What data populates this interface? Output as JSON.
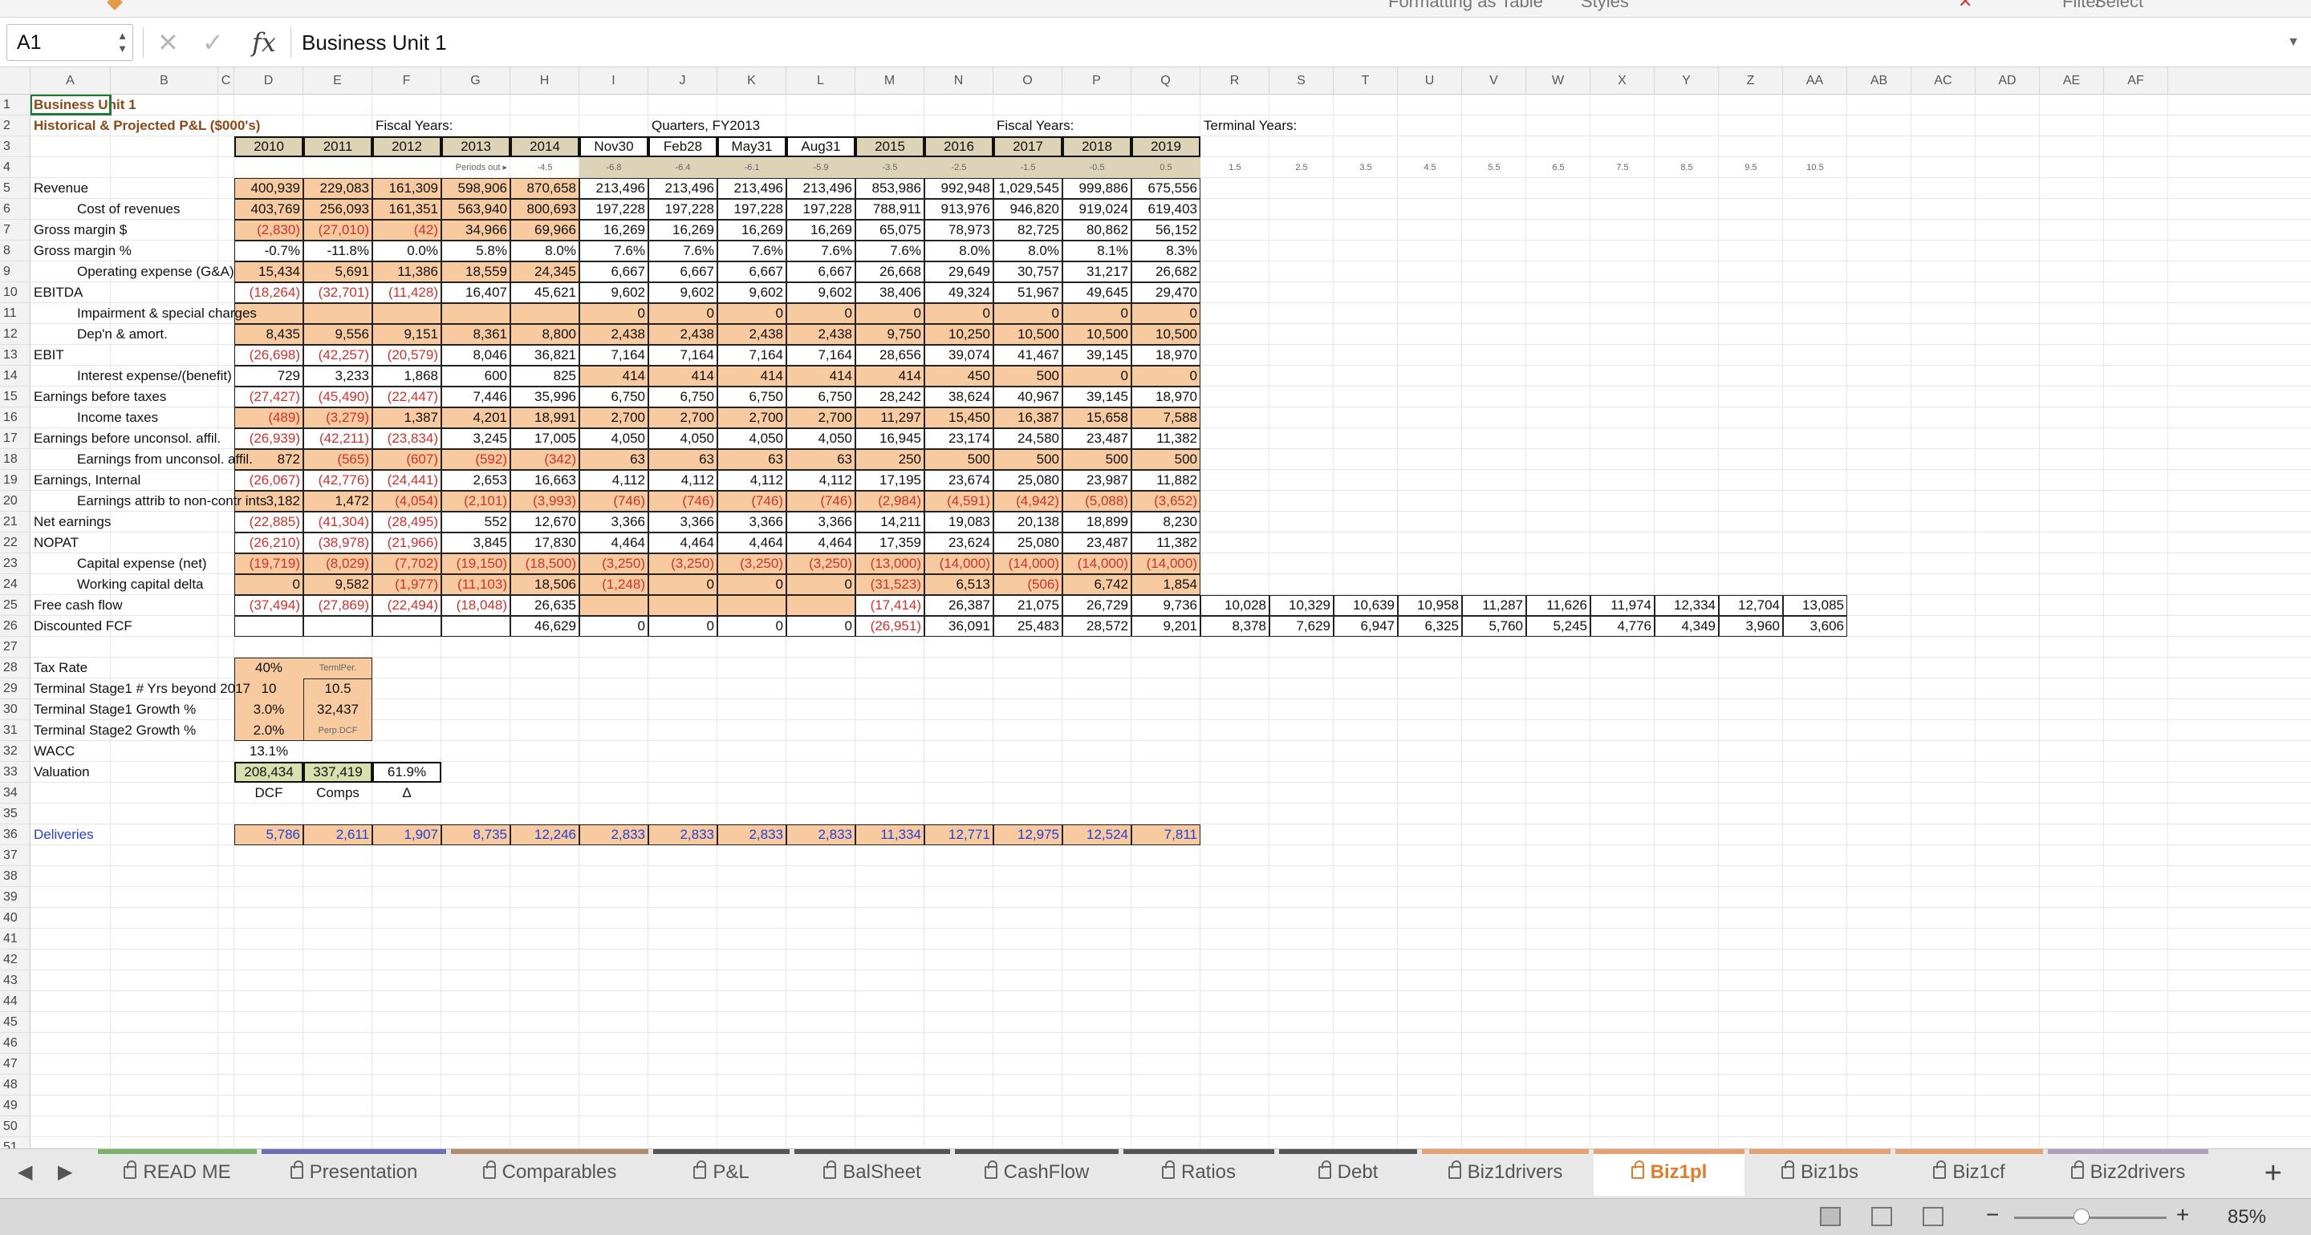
{
  "window": {
    "top_fragments": [
      "Formatting",
      "as Table",
      "Styles",
      "Filter",
      "Select"
    ]
  },
  "formula_bar": {
    "cell_ref": "A1",
    "fx_label": "fx",
    "formula_value": "Business Unit 1",
    "cancel_symbol": "✕",
    "confirm_symbol": "✓"
  },
  "columns": [
    "A",
    "B",
    "C",
    "D",
    "E",
    "F",
    "G",
    "H",
    "I",
    "J",
    "K",
    "L",
    "M",
    "N",
    "O",
    "P",
    "Q",
    "R",
    "S",
    "T",
    "U",
    "V",
    "W",
    "X",
    "Y",
    "Z",
    "AA",
    "AB",
    "AC",
    "AD",
    "AE",
    "AF"
  ],
  "rows": [
    "1",
    "2",
    "3",
    "4",
    "5",
    "6",
    "7",
    "8",
    "9",
    "10",
    "11",
    "12",
    "13",
    "14",
    "15",
    "16",
    "17",
    "18",
    "19",
    "20",
    "21",
    "22",
    "23",
    "24",
    "25",
    "26",
    "27",
    "28",
    "29",
    "30",
    "31",
    "32",
    "33",
    "34",
    "35",
    "36",
    "37",
    "38",
    "39",
    "40",
    "41",
    "42",
    "43",
    "44",
    "45",
    "46",
    "47",
    "48",
    "49",
    "50",
    "51"
  ],
  "sheet": {
    "title": "Business Unit 1",
    "subtitle": "Historical & Projected P&L ($000's)",
    "group_headers": {
      "fiscal_years_1": "Fiscal Years:",
      "quarters": "Quarters, FY2013",
      "fiscal_years_2": "Fiscal Years:",
      "terminal_years": "Terminal Years:"
    },
    "period_headers": [
      "2010",
      "2011",
      "2012",
      "2013",
      "2014",
      "Nov30",
      "Feb28",
      "May31",
      "Aug31",
      "2015",
      "2016",
      "2017",
      "2018",
      "2019"
    ],
    "periods_out_label": "Periods out ▸",
    "periods_out": [
      "-4.5",
      "-6.8",
      "-6.4",
      "-6.1",
      "-5.9",
      "-3.5",
      "-2.5",
      "-1.5",
      "-0.5",
      "0.5",
      "1.5",
      "2.5",
      "3.5",
      "4.5",
      "5.5",
      "6.5",
      "7.5",
      "8.5",
      "9.5",
      "10.5"
    ],
    "line_items": [
      {
        "row": 5,
        "label": "Revenue",
        "indent": false,
        "values": [
          "400,939",
          "229,083",
          "161,309",
          "598,906",
          "870,658",
          "213,496",
          "213,496",
          "213,496",
          "213,496",
          "853,986",
          "992,948",
          "1,029,545",
          "999,886",
          "675,556"
        ]
      },
      {
        "row": 6,
        "label": "Cost of revenues",
        "indent": true,
        "values": [
          "403,769",
          "256,093",
          "161,351",
          "563,940",
          "800,693",
          "197,228",
          "197,228",
          "197,228",
          "197,228",
          "788,911",
          "913,976",
          "946,820",
          "919,024",
          "619,403"
        ]
      },
      {
        "row": 7,
        "label": "Gross margin $",
        "indent": false,
        "values": [
          "(2,830)",
          "(27,010)",
          "(42)",
          "34,966",
          "69,966",
          "16,269",
          "16,269",
          "16,269",
          "16,269",
          "65,075",
          "78,973",
          "82,725",
          "80,862",
          "56,152"
        ]
      },
      {
        "row": 8,
        "label": "Gross margin %",
        "indent": false,
        "values": [
          "-0.7%",
          "-11.8%",
          "0.0%",
          "5.8%",
          "8.0%",
          "7.6%",
          "7.6%",
          "7.6%",
          "7.6%",
          "7.6%",
          "8.0%",
          "8.0%",
          "8.1%",
          "8.3%"
        ]
      },
      {
        "row": 9,
        "label": "Operating expense (G&A)",
        "indent": true,
        "values": [
          "15,434",
          "5,691",
          "11,386",
          "18,559",
          "24,345",
          "6,667",
          "6,667",
          "6,667",
          "6,667",
          "26,668",
          "29,649",
          "30,757",
          "31,217",
          "26,682"
        ]
      },
      {
        "row": 10,
        "label": "EBITDA",
        "indent": false,
        "values": [
          "(18,264)",
          "(32,701)",
          "(11,428)",
          "16,407",
          "45,621",
          "9,602",
          "9,602",
          "9,602",
          "9,602",
          "38,406",
          "49,324",
          "51,967",
          "49,645",
          "29,470"
        ]
      },
      {
        "row": 11,
        "label": "Impairment & special charges",
        "indent": true,
        "values": [
          "",
          "",
          "",
          "",
          "",
          "0",
          "0",
          "0",
          "0",
          "0",
          "0",
          "0",
          "0",
          "0"
        ]
      },
      {
        "row": 12,
        "label": "Dep'n & amort.",
        "indent": true,
        "values": [
          "8,435",
          "9,556",
          "9,151",
          "8,361",
          "8,800",
          "2,438",
          "2,438",
          "2,438",
          "2,438",
          "9,750",
          "10,250",
          "10,500",
          "10,500",
          "10,500"
        ]
      },
      {
        "row": 13,
        "label": "EBIT",
        "indent": false,
        "values": [
          "(26,698)",
          "(42,257)",
          "(20,579)",
          "8,046",
          "36,821",
          "7,164",
          "7,164",
          "7,164",
          "7,164",
          "28,656",
          "39,074",
          "41,467",
          "39,145",
          "18,970"
        ]
      },
      {
        "row": 14,
        "label": "Interest expense/(benefit)",
        "indent": true,
        "values": [
          "729",
          "3,233",
          "1,868",
          "600",
          "825",
          "414",
          "414",
          "414",
          "414",
          "414",
          "450",
          "500",
          "0",
          "0"
        ]
      },
      {
        "row": 15,
        "label": "Earnings before taxes",
        "indent": false,
        "values": [
          "(27,427)",
          "(45,490)",
          "(22,447)",
          "7,446",
          "35,996",
          "6,750",
          "6,750",
          "6,750",
          "6,750",
          "28,242",
          "38,624",
          "40,967",
          "39,145",
          "18,970"
        ]
      },
      {
        "row": 16,
        "label": "Income taxes",
        "indent": true,
        "values": [
          "(489)",
          "(3,279)",
          "1,387",
          "4,201",
          "18,991",
          "2,700",
          "2,700",
          "2,700",
          "2,700",
          "11,297",
          "15,450",
          "16,387",
          "15,658",
          "7,588"
        ]
      },
      {
        "row": 17,
        "label": "Earnings before unconsol. affil.",
        "indent": false,
        "values": [
          "(26,939)",
          "(42,211)",
          "(23,834)",
          "3,245",
          "17,005",
          "4,050",
          "4,050",
          "4,050",
          "4,050",
          "16,945",
          "23,174",
          "24,580",
          "23,487",
          "11,382"
        ]
      },
      {
        "row": 18,
        "label": "Earnings from unconsol. affil.",
        "indent": true,
        "values": [
          "872",
          "(565)",
          "(607)",
          "(592)",
          "(342)",
          "63",
          "63",
          "63",
          "63",
          "250",
          "500",
          "500",
          "500",
          "500"
        ]
      },
      {
        "row": 19,
        "label": "Earnings, Internal",
        "indent": false,
        "values": [
          "(26,067)",
          "(42,776)",
          "(24,441)",
          "2,653",
          "16,663",
          "4,112",
          "4,112",
          "4,112",
          "4,112",
          "17,195",
          "23,674",
          "25,080",
          "23,987",
          "11,882"
        ]
      },
      {
        "row": 20,
        "label": "Earnings attrib to non-contr ints",
        "indent": true,
        "values": [
          "3,182",
          "1,472",
          "(4,054)",
          "(2,101)",
          "(3,993)",
          "(746)",
          "(746)",
          "(746)",
          "(746)",
          "(2,984)",
          "(4,591)",
          "(4,942)",
          "(5,088)",
          "(3,652)"
        ]
      },
      {
        "row": 21,
        "label": "Net earnings",
        "indent": false,
        "values": [
          "(22,885)",
          "(41,304)",
          "(28,495)",
          "552",
          "12,670",
          "3,366",
          "3,366",
          "3,366",
          "3,366",
          "14,211",
          "19,083",
          "20,138",
          "18,899",
          "8,230"
        ]
      },
      {
        "row": 22,
        "label": "NOPAT",
        "indent": false,
        "values": [
          "(26,210)",
          "(38,978)",
          "(21,966)",
          "3,845",
          "17,830",
          "4,464",
          "4,464",
          "4,464",
          "4,464",
          "17,359",
          "23,624",
          "25,080",
          "23,487",
          "11,382"
        ]
      },
      {
        "row": 23,
        "label": "Capital expense (net)",
        "indent": true,
        "values": [
          "(19,719)",
          "(8,029)",
          "(7,702)",
          "(19,150)",
          "(18,500)",
          "(3,250)",
          "(3,250)",
          "(3,250)",
          "(3,250)",
          "(13,000)",
          "(14,000)",
          "(14,000)",
          "(14,000)",
          "(14,000)"
        ]
      },
      {
        "row": 24,
        "label": "Working capital delta",
        "indent": true,
        "values": [
          "0",
          "9,582",
          "(1,977)",
          "(11,103)",
          "18,506",
          "(1,248)",
          "0",
          "0",
          "0",
          "(31,523)",
          "6,513",
          "(506)",
          "6,742",
          "1,854"
        ]
      },
      {
        "row": 25,
        "label": "Free cash flow",
        "indent": false,
        "values": [
          "(37,494)",
          "(27,869)",
          "(22,494)",
          "(18,048)",
          "26,635",
          "",
          "",
          "",
          "",
          "(17,414)",
          "26,387",
          "21,075",
          "26,729",
          "9,736",
          "10,028",
          "10,329",
          "10,639",
          "10,958",
          "11,287",
          "11,626",
          "11,974",
          "12,334",
          "12,704",
          "13,085"
        ]
      },
      {
        "row": 26,
        "label": "Discounted FCF",
        "indent": false,
        "values": [
          "",
          "",
          "",
          "",
          "46,629",
          "0",
          "0",
          "0",
          "0",
          "(26,951)",
          "36,091",
          "25,483",
          "28,572",
          "9,201",
          "8,378",
          "7,629",
          "6,947",
          "6,325",
          "5,760",
          "5,245",
          "4,776",
          "4,349",
          "3,960",
          "3,606"
        ]
      }
    ],
    "assumptions": [
      {
        "row": 28,
        "label": "Tax Rate",
        "value": "40%",
        "side": ""
      },
      {
        "row": 29,
        "label": "Terminal Stage1 # Yrs beyond 2017",
        "value": "10",
        "side": "10.5"
      },
      {
        "row": 30,
        "label": "Terminal Stage1 Growth %",
        "value": "3.0%",
        "side": "32,437"
      },
      {
        "row": 31,
        "label": "Terminal Stage2 Growth %",
        "value": "2.0%",
        "side": ""
      },
      {
        "row": 32,
        "label": "WACC",
        "value": "13.1%",
        "side": ""
      }
    ],
    "terminal_period_label": "TermlPer.",
    "perp_dcf_label": "Perp.DCF",
    "valuation": {
      "label": "Valuation",
      "dcf": "208,434",
      "comps": "337,419",
      "delta": "61.9%",
      "dcf_label": "DCF",
      "comps_label": "Comps",
      "delta_label": "Δ"
    },
    "deliveries": {
      "label": "Deliveries",
      "values": [
        "5,786",
        "2,611",
        "1,907",
        "8,735",
        "12,246",
        "2,833",
        "2,833",
        "2,833",
        "2,833",
        "11,334",
        "12,771",
        "12,975",
        "12,524",
        "7,811"
      ]
    }
  },
  "tabs": [
    "READ ME",
    "Presentation",
    "Comparables",
    "P&L",
    "BalSheet",
    "CashFlow",
    "Ratios",
    "Debt",
    "Biz1drivers",
    "Biz1pl",
    "Biz1bs",
    "Biz1cf",
    "Biz2drivers"
  ],
  "active_tab": "Biz1pl",
  "tab_colors": [
    "#7bb36a",
    "#6a6fb3",
    "#b38a6a",
    "#555555",
    "#555555",
    "#555555",
    "#555555",
    "#555555",
    "#e8a070",
    "#e8a070",
    "#e8a070",
    "#e8a070",
    "#b0a0c0"
  ],
  "add_sheet": "+",
  "status": {
    "zoom": "85%",
    "zoom_minus": "−",
    "zoom_plus": "+"
  }
}
